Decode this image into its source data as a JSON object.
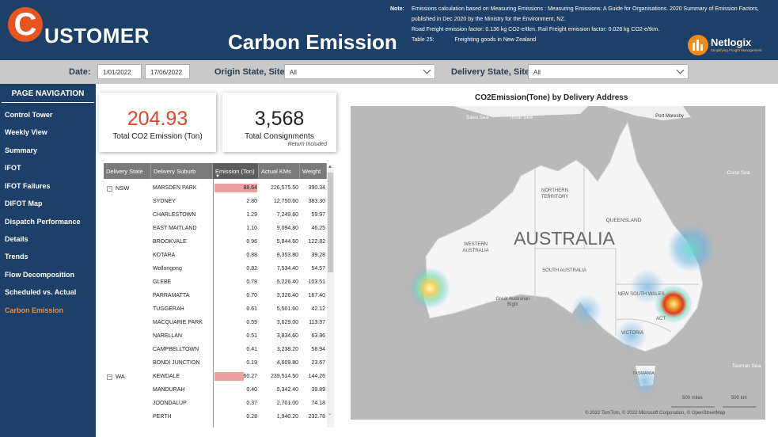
{
  "header": {
    "logo_letter": "C",
    "logo_text": "USTOMER",
    "page_title": "Carbon Emission",
    "note_label": "Note:",
    "note_line1": "Emissions calculation based on Measuring Emissions : Measuring Emissions: A Guide for Organisations. 2020 Summary of Emission Factors, published in Dec 2020 by the Ministry for the Environment, NZ.",
    "note_line2": "Road Freight emission factor: 0.136 kg CO2-e/tkm.  Rail Freight emission factor: 0.028 kg CO2-e/tkm.",
    "note_table_label": "Table 25:",
    "note_table_text": "Freighting goods in New Zealand",
    "netlogix_name": "Netlogix",
    "netlogix_tagline": "Simplifying Freight Management"
  },
  "filters": {
    "date_label": "Date:",
    "date_from": "1/01/2022",
    "date_to": "17/06/2022",
    "origin_label": "Origin State, Site:",
    "origin_value": "All",
    "delivery_label": "Delivery State, Site:",
    "delivery_value": "All"
  },
  "nav": {
    "heading": "PAGE NAVIGATION",
    "items": [
      "Control Tower",
      "Weekly View",
      "Summary",
      "IFOT",
      "IFOT Failures",
      "DIFOT Map",
      "Dispatch Performance",
      "Details",
      "Trends",
      "Flow Decomposition",
      "Scheduled vs. Actual",
      "Carbon Emission"
    ],
    "active": "Carbon Emission"
  },
  "kpis": {
    "co2_value": "204.93",
    "co2_label": "Total CO2 Emission (Ton)",
    "consign_value": "3,568",
    "consign_label": "Total Consignments",
    "consign_sub": "Return Included",
    "accent_color": "#e0462a"
  },
  "table": {
    "headers": [
      "Delivery State",
      "Delivery Suburb",
      "Emission (Ton)",
      "Actual KMs",
      "Weight"
    ],
    "groups": [
      {
        "state": "NSW",
        "rows": [
          {
            "suburb": "MARSDEN PARK",
            "emission": "88.64",
            "kms": "226,575.50",
            "weight": "390.34"
          },
          {
            "suburb": "SYDNEY",
            "emission": "2.80",
            "kms": "12,750.60",
            "weight": "383.30"
          },
          {
            "suburb": "CHARLESTOWN",
            "emission": "1.29",
            "kms": "7,249.60",
            "weight": "59.97"
          },
          {
            "suburb": "EAST MAITLAND",
            "emission": "1.10",
            "kms": "9,094.80",
            "weight": "46.25"
          },
          {
            "suburb": "BROOKVALE",
            "emission": "0.96",
            "kms": "5,844.60",
            "weight": "122.82"
          },
          {
            "suburb": "KOTARA",
            "emission": "0.88",
            "kms": "8,353.80",
            "weight": "39.28"
          },
          {
            "suburb": "Wollongong",
            "emission": "0.82",
            "kms": "7,534.40",
            "weight": "54.57"
          },
          {
            "suburb": "GLEBE",
            "emission": "0.78",
            "kms": "5,226.40",
            "weight": "103.51"
          },
          {
            "suburb": "PARRAMATTA",
            "emission": "0.70",
            "kms": "3,326.40",
            "weight": "167.40"
          },
          {
            "suburb": "TUGGERAH",
            "emission": "0.61",
            "kms": "5,501.60",
            "weight": "42.12"
          },
          {
            "suburb": "MACQUARIE PARK",
            "emission": "0.59",
            "kms": "3,629.00",
            "weight": "113.37"
          },
          {
            "suburb": "NARELLAN",
            "emission": "0.51",
            "kms": "3,834.60",
            "weight": "63.96"
          },
          {
            "suburb": "CAMPBELLTOWN",
            "emission": "0.41",
            "kms": "3,238.20",
            "weight": "58.94"
          },
          {
            "suburb": "BONDI JUNCTION",
            "emission": "0.19",
            "kms": "4,609.80",
            "weight": "23.67"
          }
        ]
      },
      {
        "state": "WA",
        "rows": [
          {
            "suburb": "KEWDALE",
            "emission": "60.27",
            "kms": "239,514.50",
            "weight": "144.26"
          },
          {
            "suburb": "MANDURAH",
            "emission": "0.40",
            "kms": "5,342.40",
            "weight": "39.89"
          },
          {
            "suburb": "JOONDALUP",
            "emission": "0.37",
            "kms": "2,701.00",
            "weight": "74.18"
          },
          {
            "suburb": "PERTH",
            "emission": "0.28",
            "kms": "1,940.20",
            "weight": "232.78"
          }
        ]
      }
    ],
    "bar_color": "#f0a0a0"
  },
  "map": {
    "title": "CO2Emission(Tone) by Delivery Address",
    "country_label": "AUSTRALIA",
    "region_labels": [
      "NORTHERN TERRITORY",
      "QUEENSLAND",
      "WESTERN AUSTRALIA",
      "SOUTH AUSTRALIA",
      "NEW SOUTH WALES",
      "VICTORIA",
      "ACT",
      "TASMANIA"
    ],
    "sea_labels": [
      "Coral Sea",
      "Great Australian Bight",
      "Tasman Sea"
    ],
    "place_labels": [
      "Savu Sea",
      "Timor Sea",
      "Port Moresby"
    ],
    "scale_miles": "500 miles",
    "scale_km": "500 km",
    "attribution": "© 2022 TomTom, © 2022 Microsoft Corporation, © OpenStreetMap"
  }
}
